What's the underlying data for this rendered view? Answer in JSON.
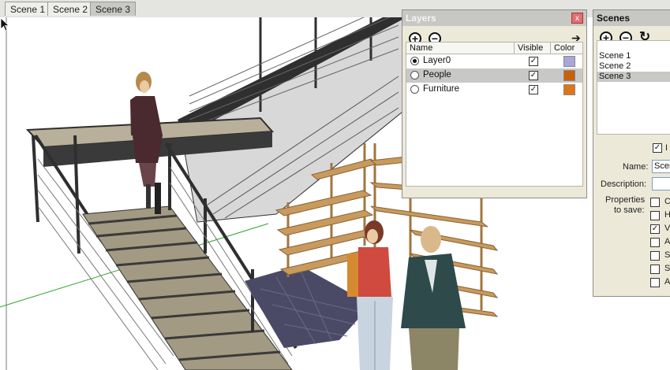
{
  "scene_tabs": [
    {
      "label": "Scene 1"
    },
    {
      "label": "Scene 2"
    },
    {
      "label": "Scene 3"
    }
  ],
  "layers_panel": {
    "title": "Layers",
    "close": "x",
    "add": "+",
    "remove": "−",
    "details": "➔",
    "columns": {
      "name": "Name",
      "visible": "Visible",
      "color": "Color"
    },
    "layers": [
      {
        "name": "Layer0",
        "active": true,
        "visible": "✓",
        "color": "#a7a7d9"
      },
      {
        "name": "People",
        "active": false,
        "visible": "✓",
        "color": "#c9600c"
      },
      {
        "name": "Furniture",
        "active": false,
        "visible": "✓",
        "color": "#e07418"
      }
    ]
  },
  "scenes_panel": {
    "title": "Scenes",
    "add": "+",
    "remove": "−",
    "refresh": "↻",
    "items": [
      "Scene 1",
      "Scene 2",
      "Scene 3"
    ],
    "selected": "Scene 3",
    "include_check": "✓",
    "include_label": "I",
    "name_label": "Name:",
    "name_value": "Scen",
    "description_label": "Description:",
    "description_value": "",
    "properties_label_1": "Properties",
    "properties_label_2": "to save:",
    "properties": [
      {
        "checked": "",
        "label": "C"
      },
      {
        "checked": "",
        "label": "H"
      },
      {
        "checked": "✓",
        "label": "V"
      },
      {
        "checked": "",
        "label": "A"
      },
      {
        "checked": "",
        "label": "S"
      },
      {
        "checked": "",
        "label": "S"
      },
      {
        "checked": "",
        "label": "A"
      }
    ]
  },
  "colors": {
    "stair_metal": "#2f2f2f",
    "tread": "#a39a83",
    "shelf_wood": "#c89a5e",
    "axis_green": "#2aa52a",
    "floor_tile": "#4a4a66"
  }
}
